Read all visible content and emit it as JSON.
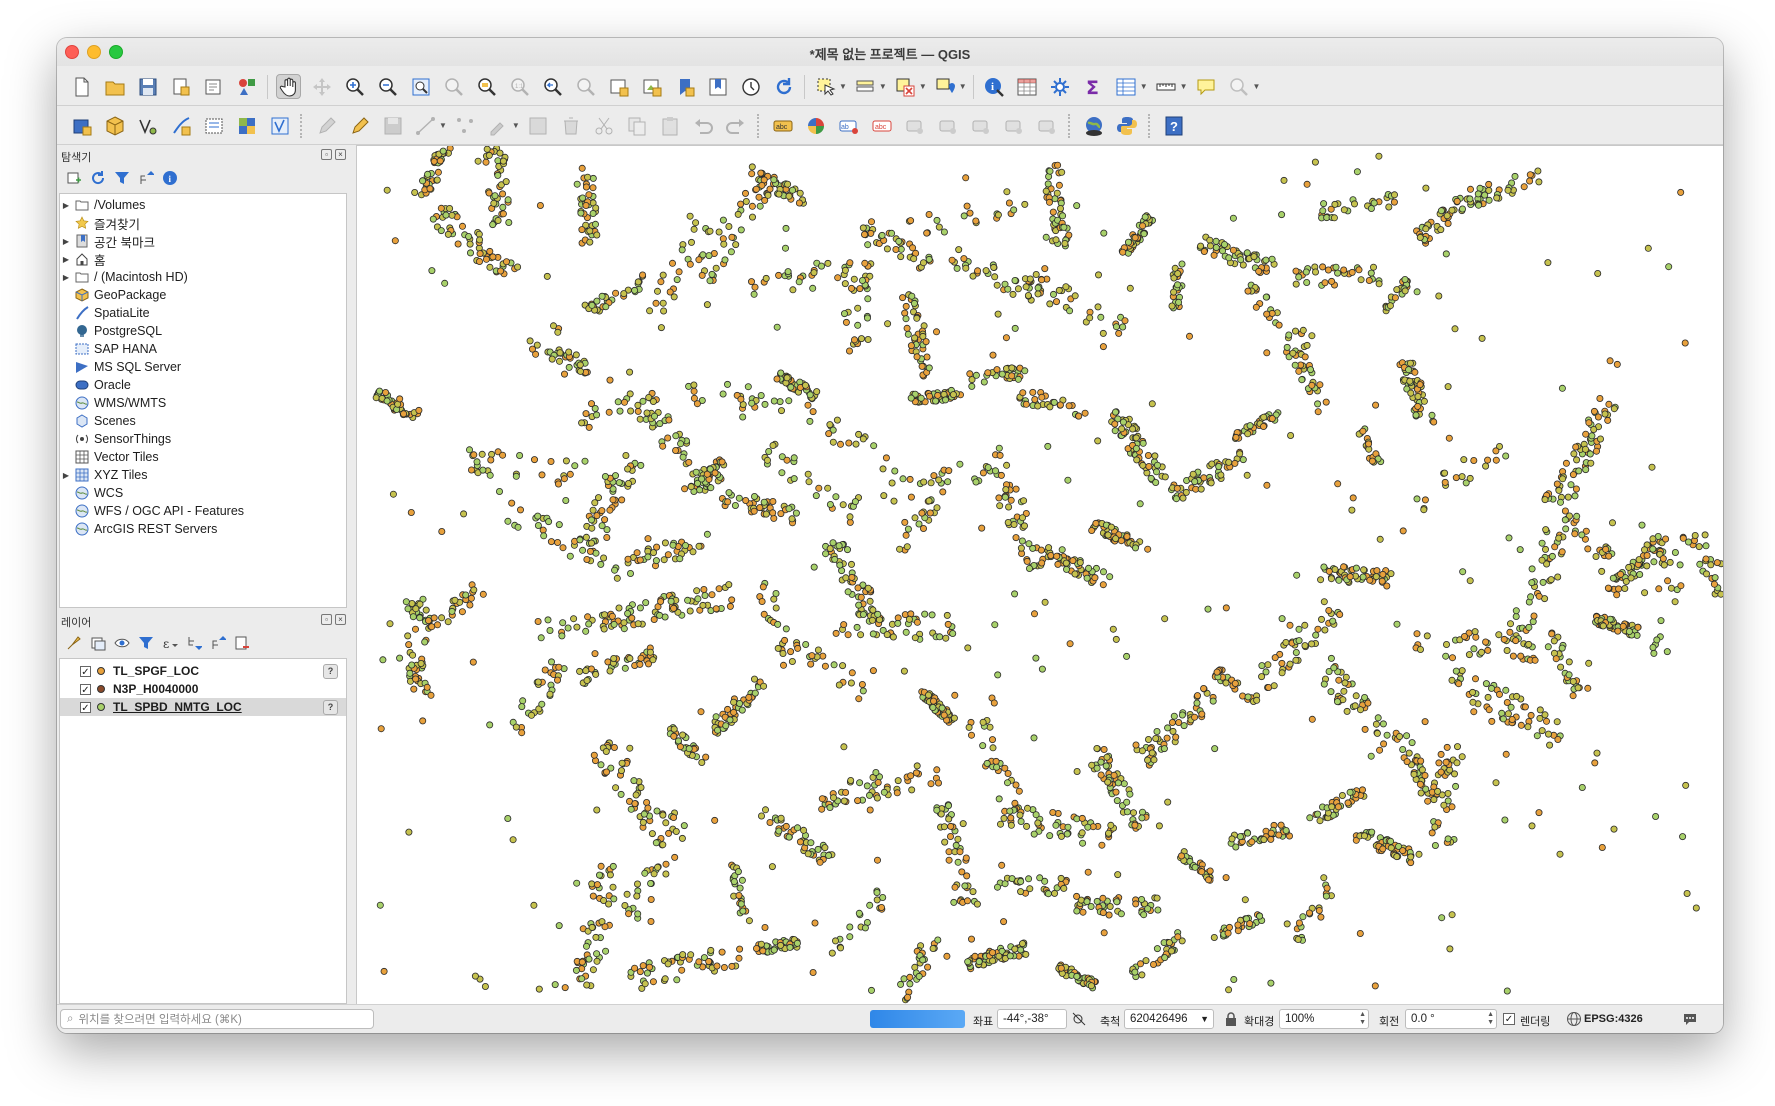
{
  "window": {
    "title": "*제목 없는 프로젝트 — QGIS"
  },
  "browser_panel": {
    "title": "탐색기",
    "items": [
      {
        "label": "/Volumes",
        "icon": "folder-icon",
        "expandable": true
      },
      {
        "label": "즐겨찾기",
        "icon": "star-icon",
        "expandable": false
      },
      {
        "label": "공간 북마크",
        "icon": "bookmark-icon",
        "expandable": true
      },
      {
        "label": "홈",
        "icon": "home-icon",
        "expandable": true
      },
      {
        "label": "/ (Macintosh HD)",
        "icon": "folder-icon",
        "expandable": true
      },
      {
        "label": "GeoPackage",
        "icon": "geopackage-icon",
        "expandable": false
      },
      {
        "label": "SpatiaLite",
        "icon": "spatialite-icon",
        "expandable": false
      },
      {
        "label": "PostgreSQL",
        "icon": "postgresql-icon",
        "expandable": false
      },
      {
        "label": "SAP HANA",
        "icon": "sap-hana-icon",
        "expandable": false
      },
      {
        "label": "MS SQL Server",
        "icon": "mssql-icon",
        "expandable": false
      },
      {
        "label": "Oracle",
        "icon": "oracle-icon",
        "expandable": false
      },
      {
        "label": "WMS/WMTS",
        "icon": "globe-icon",
        "expandable": false
      },
      {
        "label": "Scenes",
        "icon": "scene-icon",
        "expandable": false
      },
      {
        "label": "SensorThings",
        "icon": "sensor-icon",
        "expandable": false
      },
      {
        "label": "Vector Tiles",
        "icon": "vector-tiles-icon",
        "expandable": false
      },
      {
        "label": "XYZ Tiles",
        "icon": "xyz-tiles-icon",
        "expandable": true
      },
      {
        "label": "WCS",
        "icon": "globe-icon",
        "expandable": false
      },
      {
        "label": "WFS / OGC API - Features",
        "icon": "globe-icon",
        "expandable": false
      },
      {
        "label": "ArcGIS REST Servers",
        "icon": "globe-icon",
        "expandable": false
      }
    ]
  },
  "layers_panel": {
    "title": "레이어",
    "layers": [
      {
        "name": "TL_SPGF_LOC",
        "checked": true,
        "symbol_color": "#e8a13c",
        "has_help": true,
        "selected": false
      },
      {
        "name": "N3P_H0040000",
        "checked": true,
        "symbol_color": "#8a4a2a",
        "has_help": false,
        "selected": false
      },
      {
        "name": "TL_SPBD_NMTG_LOC",
        "checked": true,
        "symbol_color": "#a8d16a",
        "has_help": true,
        "selected": true
      }
    ]
  },
  "map": {
    "point_colors": [
      "#e8a13c",
      "#a8d16a",
      "#c6c24e"
    ],
    "stroke_color": "#2b2b2b"
  },
  "status": {
    "locator_placeholder": "위치를 찾으려면 입력하세요 (⌘K)",
    "coord_label": "좌표",
    "coord_value": "-44°,-38°",
    "scale_label": "축척",
    "scale_value": "620426496",
    "magnifier_label": "확대경",
    "magnifier_value": "100%",
    "rotation_label": "회전",
    "rotation_value": "0.0 °",
    "render_label": "렌더링",
    "render_checked": true,
    "crs_label": "EPSG:4326"
  },
  "help_badge": "?"
}
